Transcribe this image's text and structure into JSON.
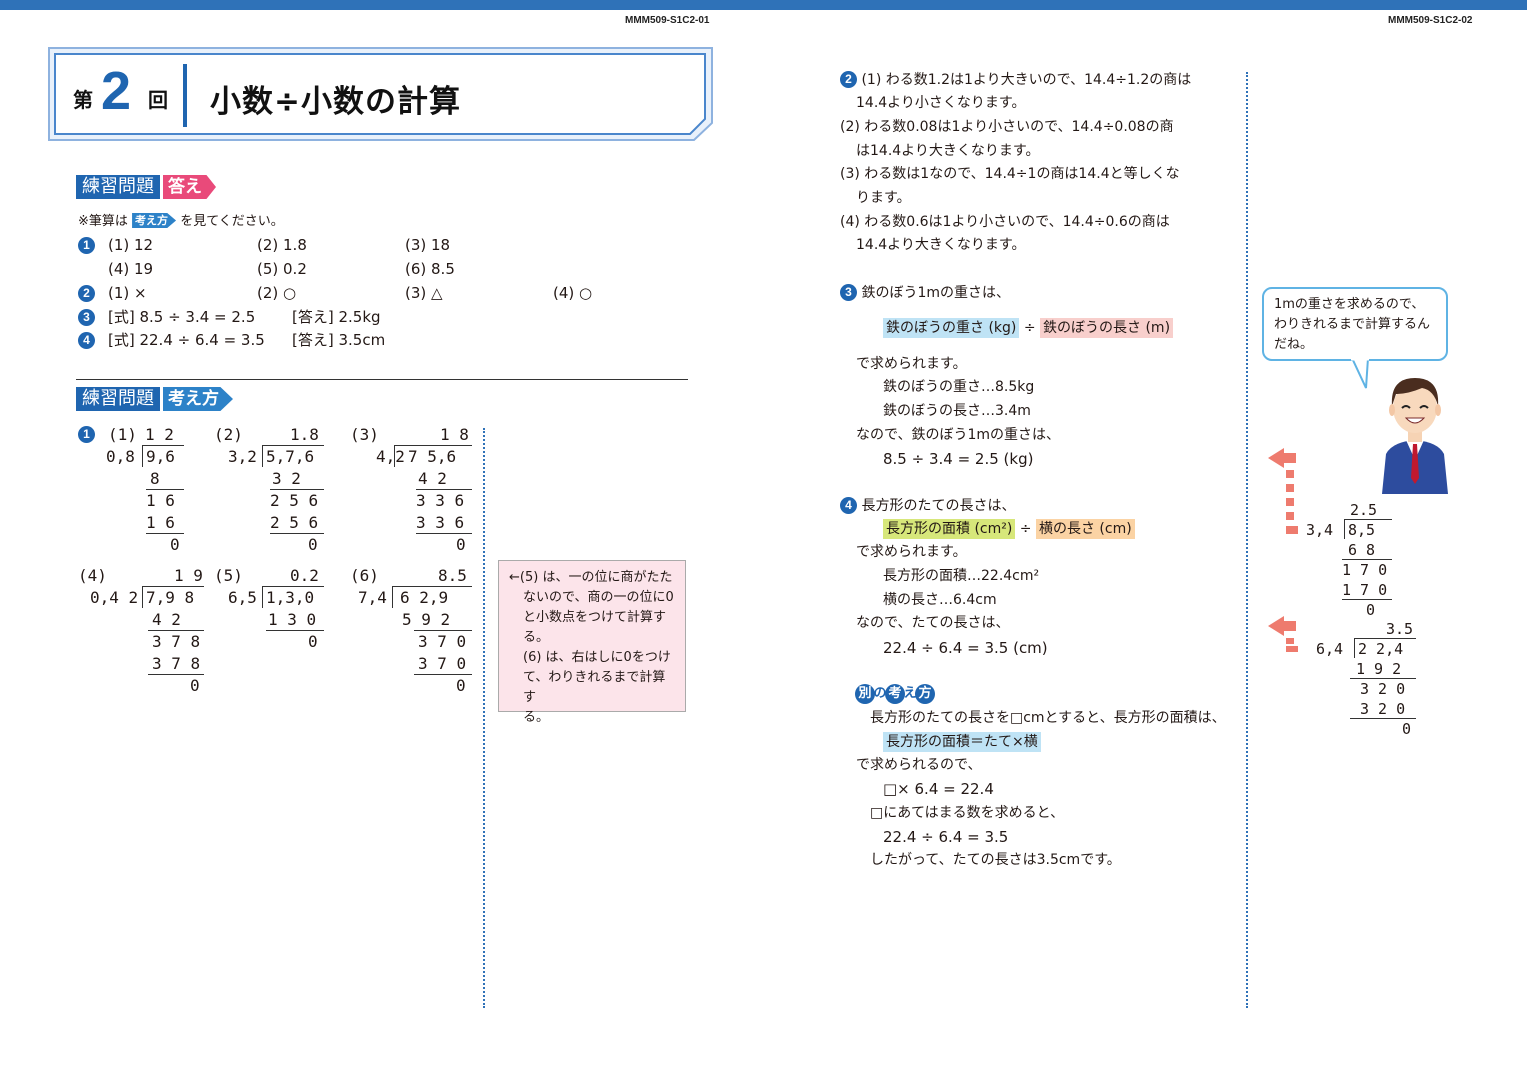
{
  "header": {
    "page_code_left": "MMM509-S1C2-01",
    "page_code_right": "MMM509-S1C2-02"
  },
  "title": {
    "dai": "第",
    "number": "2",
    "kai": "回",
    "text": "小数÷小数の計算"
  },
  "answers_section": {
    "heading": "練習問題",
    "tag": "答え",
    "note_prefix": "※筆算は",
    "note_tag": "考え方",
    "note_suffix": "を見てください。",
    "q1": {
      "badge": "1",
      "items": [
        "(1) 12",
        "(2) 1.8",
        "(3) 18",
        "(4) 19",
        "(5) 0.2",
        "(6) 8.5"
      ]
    },
    "q2": {
      "badge": "2",
      "items": [
        "(1) ×",
        "(2) ○",
        "(3) △",
        "(4) ○"
      ]
    },
    "q3": {
      "badge": "3",
      "formula": "[式] 8.5 ÷ 3.4 = 2.5",
      "answer": "[答え] 2.5kg"
    },
    "q4": {
      "badge": "4",
      "formula": "[式] 22.4 ÷ 6.4 = 3.5",
      "answer": "[答え] 3.5cm"
    }
  },
  "thinking_section": {
    "heading": "練習問題",
    "tag": "考え方",
    "badge": "1",
    "divisions": [
      {
        "label": "(1)",
        "quotient": "1 2",
        "divisor": "0,8",
        "dividend": "9,6",
        "steps": [
          "8",
          "1 6",
          "1 6",
          "0"
        ]
      },
      {
        "label": "(2)",
        "quotient": "1.8",
        "divisor": "3,2",
        "dividend": "5,7,6",
        "steps": [
          "3 2",
          "2 5 6",
          "2 5 6",
          "0"
        ]
      },
      {
        "label": "(3)",
        "quotient": "1 8",
        "divisor": "4,2",
        "dividend": "7 5,6",
        "steps": [
          "4 2",
          "3 3 6",
          "3 3 6",
          "0"
        ]
      },
      {
        "label": "(4)",
        "quotient": "1 9",
        "divisor": "0,4 2",
        "dividend": "7,9 8",
        "steps": [
          "4 2",
          "3 7 8",
          "3 7 8",
          "0"
        ]
      },
      {
        "label": "(5)",
        "quotient": "0.2",
        "divisor": "6,5",
        "dividend": "1,3,0",
        "steps": [
          "1 3 0",
          "0"
        ]
      },
      {
        "label": "(6)",
        "quotient": "8.5",
        "divisor": "7,4",
        "dividend": "6 2,9",
        "steps": [
          "5 9 2",
          "3 7 0",
          "3 7 0",
          "0"
        ]
      }
    ],
    "note": [
      "←(5) は、一の位に商がたた",
      "ないので、商の一の位に0",
      "と小数点をつけて計算する。",
      "(6) は、右はしに0をつけ",
      "て、わりきれるまで計算す",
      "る。"
    ]
  },
  "right_page": {
    "q2": {
      "badge": "2",
      "lines": [
        "(1) わる数1.2は1より大きいので、14.4÷1.2の商は",
        "14.4より小さくなります。",
        "(2) わる数0.08は1より小さいので、14.4÷0.08の商",
        "は14.4より大きくなります。",
        "(3) わる数は1なので、14.4÷1の商は14.4と等しくな",
        "ります。",
        "(4) わる数0.6は1より小さいので、14.4÷0.6の商は",
        "14.4より大きくなります。"
      ]
    },
    "q3": {
      "badge": "3",
      "intro": "鉄のぼう1mの重さは、",
      "formula_a": "鉄のぼうの重さ (kg)",
      "formula_op": "÷",
      "formula_b": "鉄のぼうの長さ (m)",
      "lines": [
        "で求められます。",
        "鉄のぼうの重さ…8.5kg",
        "鉄のぼうの長さ…3.4m",
        "なので、鉄のぼう1mの重さは、",
        "8.5 ÷ 3.4 = 2.5 (kg)"
      ]
    },
    "q4": {
      "badge": "4",
      "intro": "長方形のたての長さは、",
      "formula_a": "長方形の面積 (cm²)",
      "formula_op": "÷",
      "formula_b": "横の長さ (cm)",
      "lines": [
        "で求められます。",
        "長方形の面積…22.4cm²",
        "横の長さ…6.4cm",
        "なので、たての長さは、",
        "22.4 ÷ 6.4 = 3.5 (cm)"
      ]
    },
    "alt": {
      "chars": [
        "別",
        "の",
        "考",
        "え",
        "方"
      ],
      "line1": "長方形のたての長さを□cmとすると、長方形の面積は、",
      "formula": "長方形の面積＝たて×横",
      "lines": [
        "で求められるので、",
        "□× 6.4 = 22.4",
        "□にあてはまる数を求めると、",
        "22.4 ÷ 6.4 = 3.5",
        "したがって、たての長さは3.5cmです。"
      ]
    },
    "bubble": [
      "1mの重さを求めるので、",
      "わりきれるまで計算するん",
      "だね。"
    ],
    "side_div1": {
      "quotient": "2.5",
      "divisor": "3,4",
      "dividend": "8,5",
      "steps": [
        "6 8",
        "1 7 0",
        "1 7 0",
        "0"
      ]
    },
    "side_div2": {
      "quotient": "3.5",
      "divisor": "6,4",
      "dividend": "2 2,4",
      "steps": [
        "1 9 2",
        "3 2 0",
        "3 2 0",
        "0"
      ]
    },
    "colors": {
      "brand": "#1f65b0",
      "accent_pink": "#e94a7a",
      "arrow": "#ee7b6e"
    }
  }
}
